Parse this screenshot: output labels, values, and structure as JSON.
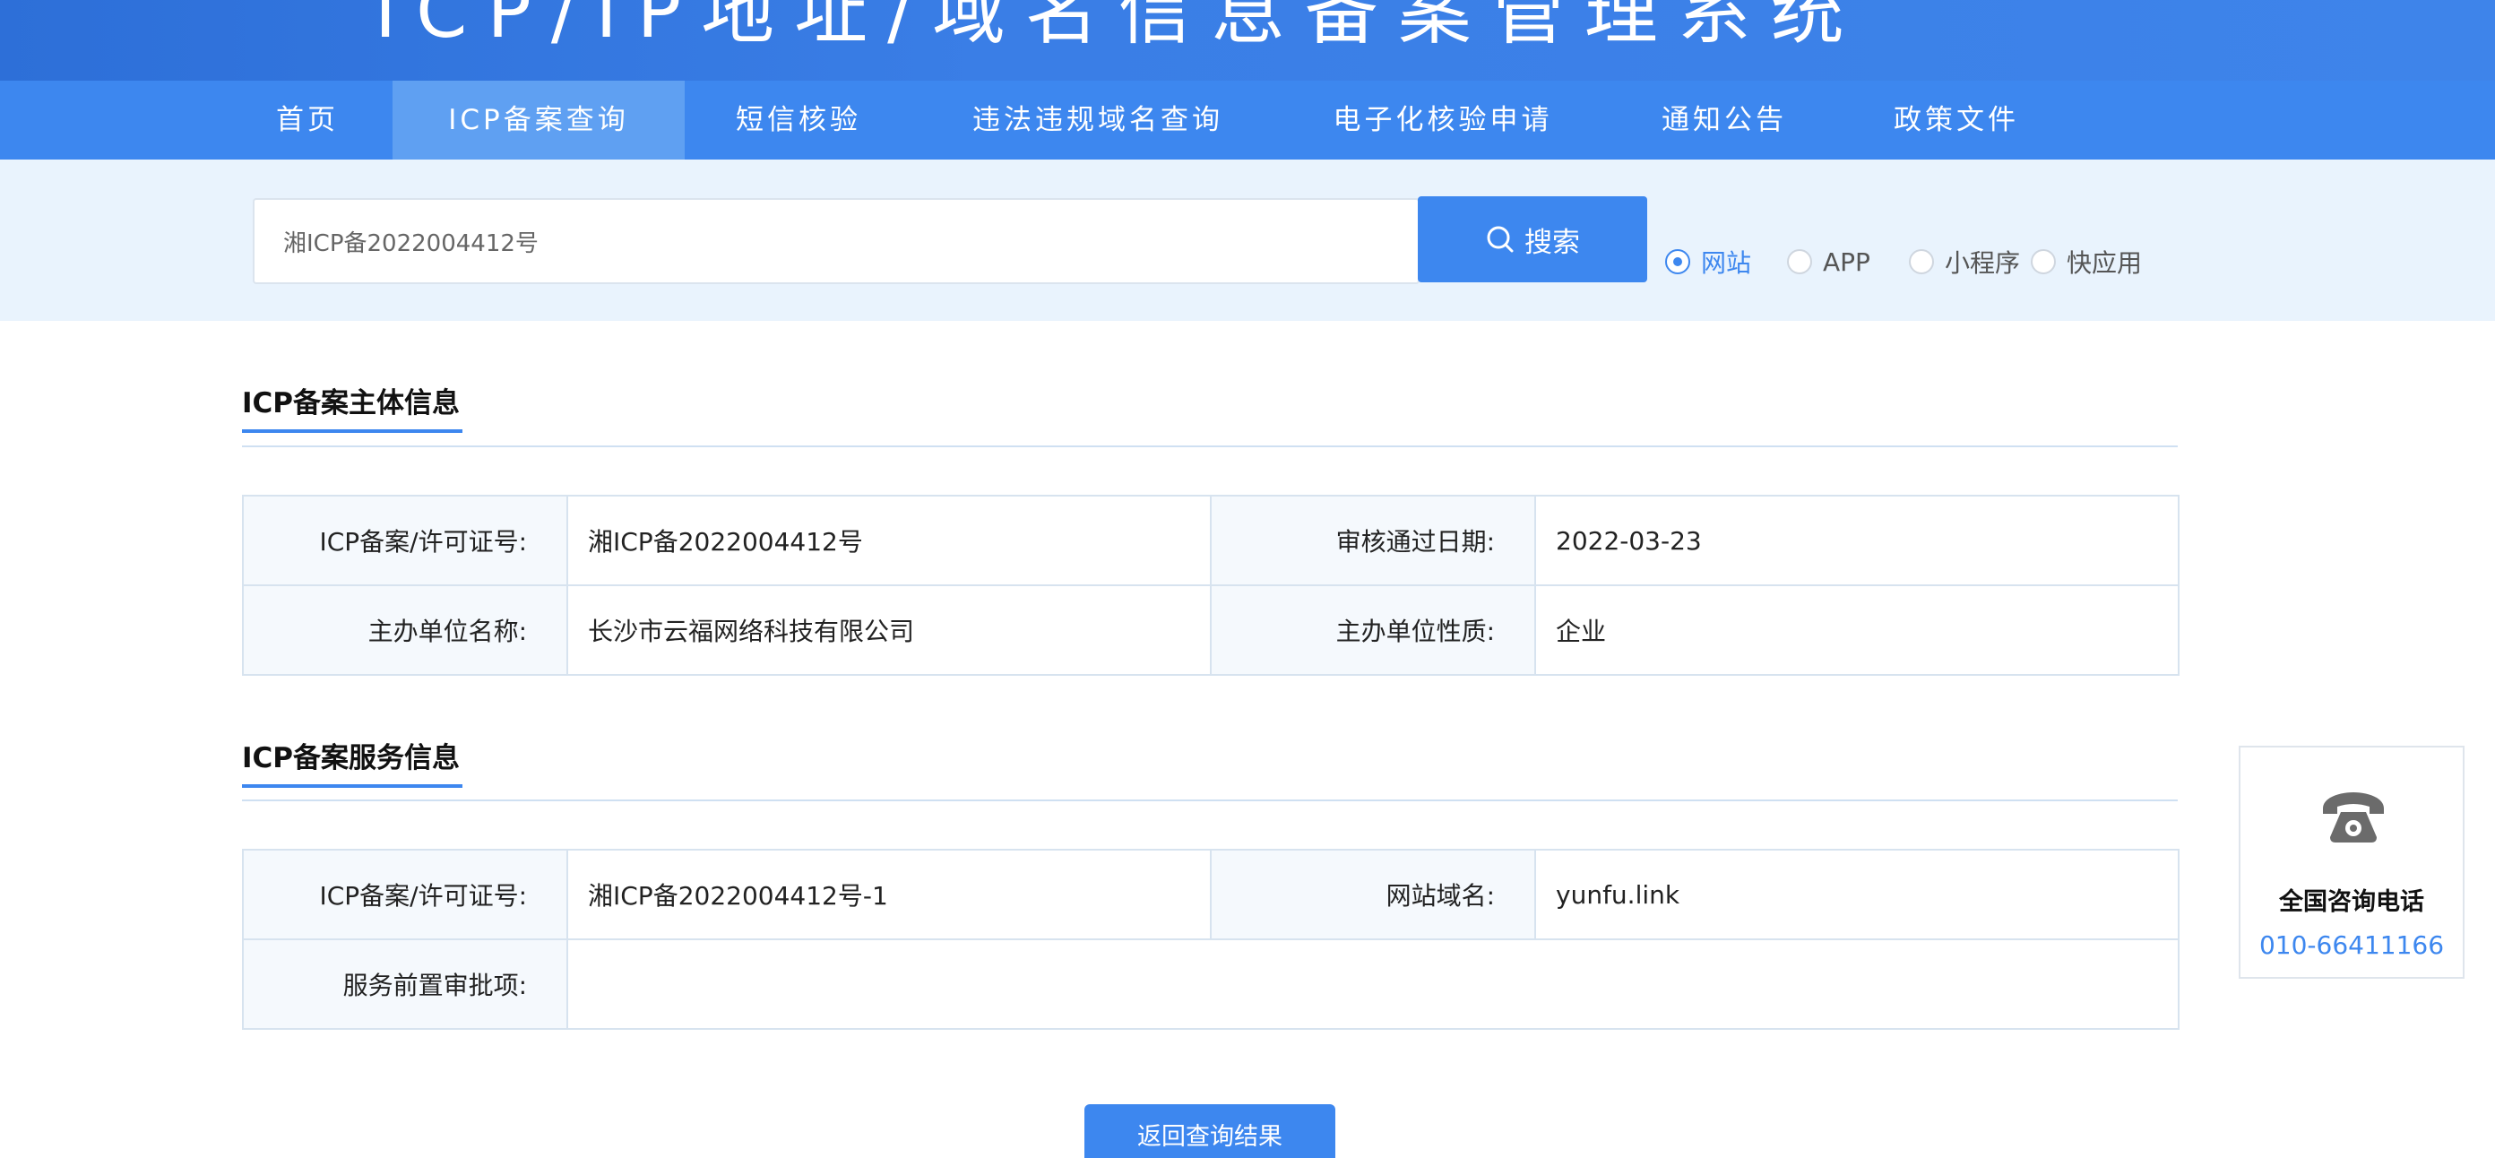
{
  "header": {
    "title": "ICP/IP地址/域名信息备案管理系统"
  },
  "nav": {
    "items": [
      {
        "label": "首页"
      },
      {
        "label": "ICP备案查询"
      },
      {
        "label": "短信核验"
      },
      {
        "label": "违法违规域名查询"
      },
      {
        "label": "电子化核验申请"
      },
      {
        "label": "通知公告"
      },
      {
        "label": "政策文件"
      }
    ],
    "active_index": 1
  },
  "search": {
    "value": "湘ICP备2022004412号",
    "button_label": "搜索",
    "options": [
      {
        "label": "网站",
        "checked": true
      },
      {
        "label": "APP",
        "checked": false
      },
      {
        "label": "小程序",
        "checked": false
      },
      {
        "label": "快应用",
        "checked": false
      }
    ]
  },
  "subject_info": {
    "title": "ICP备案主体信息",
    "rows": [
      {
        "k1": "ICP备案/许可证号:",
        "v1": "湘ICP备2022004412号",
        "k2": "审核通过日期:",
        "v2": "2022-03-23"
      },
      {
        "k1": "主办单位名称:",
        "v1": "长沙市云福网络科技有限公司",
        "k2": "主办单位性质:",
        "v2": "企业"
      }
    ]
  },
  "service_info": {
    "title": "ICP备案服务信息",
    "rows": [
      {
        "k1": "ICP备案/许可证号:",
        "v1": "湘ICP备2022004412号-1",
        "k2": "网站域名:",
        "v2": "yunfu.link"
      },
      {
        "k1": "服务前置审批项:",
        "v1": ""
      }
    ]
  },
  "consult": {
    "title": "全国咨询电话",
    "phone": "010-66411166"
  },
  "return_button": {
    "label": "返回查询结果"
  },
  "colors": {
    "primary": "#3d87ef",
    "nav_active": "#5fa0f2",
    "search_band": "#e9f3fd"
  }
}
